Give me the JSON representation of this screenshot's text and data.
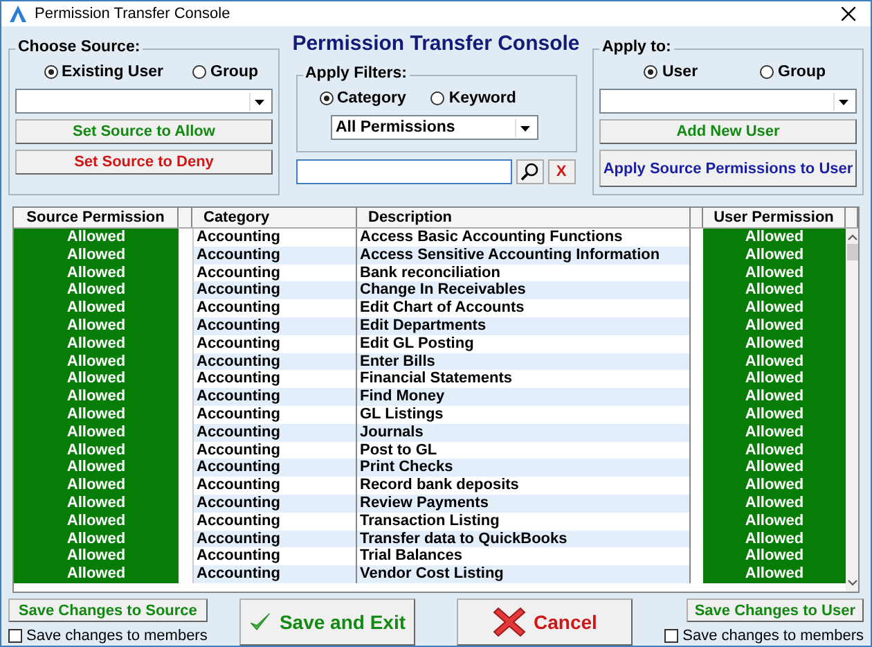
{
  "window": {
    "title": "Permission Transfer Console"
  },
  "heading": "Permission Transfer Console",
  "source": {
    "legend": "Choose Source:",
    "options": [
      {
        "label": "Existing User",
        "selected": true
      },
      {
        "label": "Group",
        "selected": false
      }
    ],
    "buttons": [
      {
        "label": "Set Source to Allow",
        "kind": "allow"
      },
      {
        "label": "Set Source to Deny",
        "kind": "deny"
      }
    ]
  },
  "filters": {
    "legend": "Apply Filters:",
    "options": [
      {
        "label": "Category",
        "selected": true
      },
      {
        "label": "Keyword",
        "selected": false
      }
    ],
    "dropdown": {
      "value": "All Permissions"
    },
    "clear_button": "X"
  },
  "apply_to": {
    "legend": "Apply to:",
    "options": [
      {
        "label": "User",
        "selected": true
      },
      {
        "label": "Group",
        "selected": false
      }
    ],
    "buttons": [
      {
        "label": "Add New User",
        "kind": "allow"
      },
      {
        "label": "Apply Source Permissions to User",
        "kind": "apply"
      }
    ]
  },
  "table": {
    "columns": [
      "Source Permission",
      "Category",
      "Description",
      "User Permission"
    ],
    "rows": [
      {
        "source": "Allowed",
        "category": "Accounting",
        "description": "Access Basic Accounting Functions",
        "user": "Allowed"
      },
      {
        "source": "Allowed",
        "category": "Accounting",
        "description": "Access Sensitive Accounting Information",
        "user": "Allowed"
      },
      {
        "source": "Allowed",
        "category": "Accounting",
        "description": "Bank reconciliation",
        "user": "Allowed"
      },
      {
        "source": "Allowed",
        "category": "Accounting",
        "description": "Change In Receivables",
        "user": "Allowed"
      },
      {
        "source": "Allowed",
        "category": "Accounting",
        "description": "Edit Chart of Accounts",
        "user": "Allowed"
      },
      {
        "source": "Allowed",
        "category": "Accounting",
        "description": "Edit Departments",
        "user": "Allowed"
      },
      {
        "source": "Allowed",
        "category": "Accounting",
        "description": "Edit GL Posting",
        "user": "Allowed"
      },
      {
        "source": "Allowed",
        "category": "Accounting",
        "description": "Enter Bills",
        "user": "Allowed"
      },
      {
        "source": "Allowed",
        "category": "Accounting",
        "description": "Financial Statements",
        "user": "Allowed"
      },
      {
        "source": "Allowed",
        "category": "Accounting",
        "description": "Find Money",
        "user": "Allowed"
      },
      {
        "source": "Allowed",
        "category": "Accounting",
        "description": "GL Listings",
        "user": "Allowed"
      },
      {
        "source": "Allowed",
        "category": "Accounting",
        "description": "Journals",
        "user": "Allowed"
      },
      {
        "source": "Allowed",
        "category": "Accounting",
        "description": "Post to GL",
        "user": "Allowed"
      },
      {
        "source": "Allowed",
        "category": "Accounting",
        "description": "Print Checks",
        "user": "Allowed"
      },
      {
        "source": "Allowed",
        "category": "Accounting",
        "description": "Record bank deposits",
        "user": "Allowed"
      },
      {
        "source": "Allowed",
        "category": "Accounting",
        "description": "Review Payments",
        "user": "Allowed"
      },
      {
        "source": "Allowed",
        "category": "Accounting",
        "description": "Transaction Listing",
        "user": "Allowed"
      },
      {
        "source": "Allowed",
        "category": "Accounting",
        "description": "Transfer data to QuickBooks",
        "user": "Allowed"
      },
      {
        "source": "Allowed",
        "category": "Accounting",
        "description": "Trial Balances",
        "user": "Allowed"
      },
      {
        "source": "Allowed",
        "category": "Accounting",
        "description": "Vendor Cost Listing",
        "user": "Allowed"
      }
    ]
  },
  "footer": {
    "left": {
      "button": "Save Changes to Source",
      "checkbox": {
        "label": "Save changes to members",
        "checked": false
      }
    },
    "save": "Save and Exit",
    "cancel": "Cancel",
    "right": {
      "button": "Save Changes to User",
      "checkbox": {
        "label": "Save changes to members",
        "checked": false
      }
    }
  }
}
